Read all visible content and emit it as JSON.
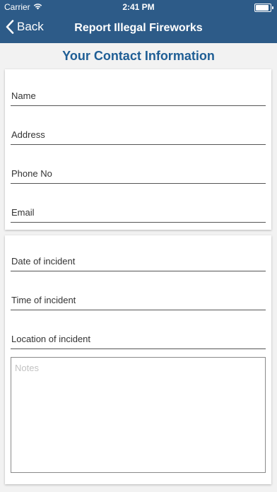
{
  "status_bar": {
    "carrier": "Carrier",
    "time": "2:41 PM"
  },
  "nav": {
    "back_label": "Back",
    "title": "Report Illegal Fireworks"
  },
  "section_title": "Your Contact Information",
  "contact_fields": {
    "name": "Name",
    "address": "Address",
    "phone": "Phone No",
    "email": "Email"
  },
  "incident_fields": {
    "date": "Date of incident",
    "time": "Time of incident",
    "location": "Location of incident",
    "notes_placeholder": "Notes"
  },
  "colors": {
    "nav_background": "#2d5b88",
    "section_title": "#1f5e95"
  }
}
